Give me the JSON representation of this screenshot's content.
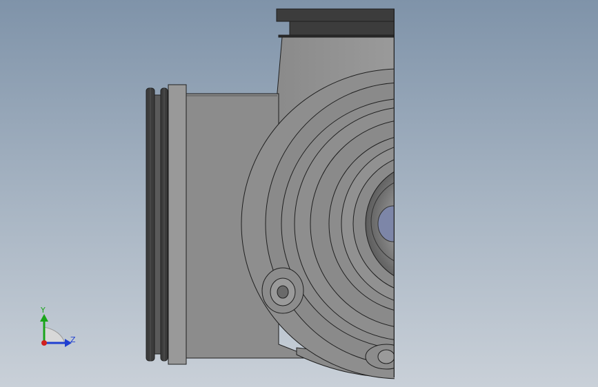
{
  "axes": {
    "y_label": "Y",
    "z_label": "Z",
    "y_color": "#1aa51a",
    "z_color": "#1f3fd1",
    "origin_color": "#d11f1f"
  },
  "model": {
    "view": "side-view",
    "body_color": "#8c8c8c",
    "dark_color": "#3c3c3c",
    "edge_color": "#1e1e1e"
  }
}
